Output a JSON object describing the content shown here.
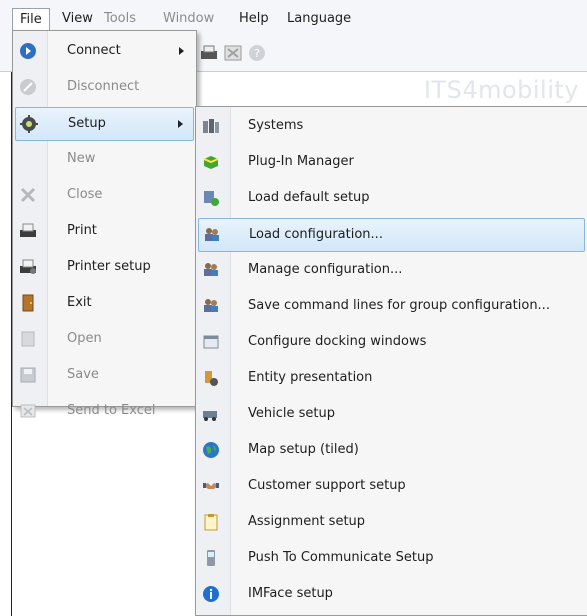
{
  "menubar": {
    "items": [
      {
        "label": "File"
      },
      {
        "label": "View"
      },
      {
        "label": "Tools"
      },
      {
        "label": "Window"
      },
      {
        "label": "Help"
      },
      {
        "label": "Language"
      }
    ]
  },
  "watermark": "ITS4mobility",
  "file_menu": {
    "items": [
      {
        "label": "Connect",
        "icon": "connect-icon"
      },
      {
        "label": "Disconnect",
        "icon": "disconnect-icon"
      },
      {
        "label": "Setup",
        "icon": "gear-icon"
      },
      {
        "label": "New",
        "icon": ""
      },
      {
        "label": "Close",
        "icon": "close-icon"
      },
      {
        "label": "Print",
        "icon": "printer-icon"
      },
      {
        "label": "Printer setup",
        "icon": "printer-setup-icon"
      },
      {
        "label": "Exit",
        "icon": "door-icon"
      },
      {
        "label": "Open",
        "icon": "open-icon"
      },
      {
        "label": "Save",
        "icon": "save-icon"
      },
      {
        "label": "Send to Excel",
        "icon": "excel-icon"
      }
    ]
  },
  "setup_menu": {
    "items": [
      {
        "label": "Systems",
        "icon": "systems-icon"
      },
      {
        "label": "Plug-In Manager",
        "icon": "plugin-icon"
      },
      {
        "label": "Load default setup",
        "icon": "load-default-icon"
      },
      {
        "label": "Load configuration...",
        "icon": "users-config-icon"
      },
      {
        "label": "Manage configuration...",
        "icon": "users-config-icon"
      },
      {
        "label": "Save command lines for group configuration...",
        "icon": "users-config-icon"
      },
      {
        "label": "Configure docking windows",
        "icon": "docking-windows-icon"
      },
      {
        "label": "Entity presentation",
        "icon": "entity-icon"
      },
      {
        "label": "Vehicle setup",
        "icon": "vehicle-icon"
      },
      {
        "label": "Map setup (tiled)",
        "icon": "globe-icon"
      },
      {
        "label": "Customer support setup",
        "icon": "handshake-icon"
      },
      {
        "label": "Assignment setup",
        "icon": "clipboard-icon"
      },
      {
        "label": "Push To Communicate Setup",
        "icon": "phone-icon"
      },
      {
        "label": "IMFace setup",
        "icon": "info-icon"
      }
    ]
  },
  "colors": {
    "highlight": "#d3e7f8",
    "highlight_border": "#86b6e2",
    "disabled_text": "#8a8a8a"
  }
}
